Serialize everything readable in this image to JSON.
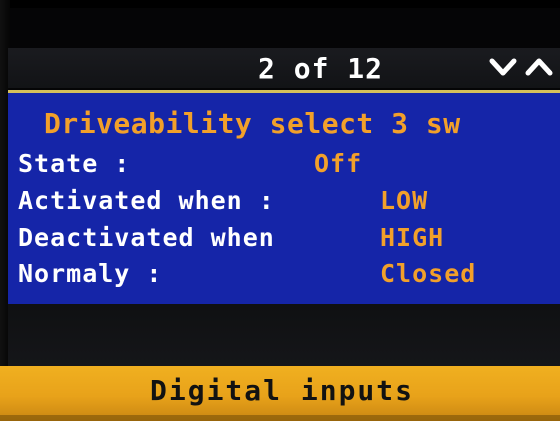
{
  "header": {
    "page_indicator": "2 of 12",
    "nav": {
      "up_icon": "chevron-up-icon",
      "down_icon": "chevron-down-icon"
    }
  },
  "panel": {
    "title": "Driveability select 3 sw",
    "rows": [
      {
        "label": "State  :",
        "value": "Off"
      },
      {
        "label": "Activated when :",
        "value": "LOW"
      },
      {
        "label": "Deactivated when",
        "value": "HIGH"
      },
      {
        "label": "Normaly :",
        "value": "Closed"
      }
    ]
  },
  "footer": {
    "label": "Digital inputs"
  },
  "colors": {
    "panel_background": "#1525a8",
    "accent_value": "#f2a02a",
    "label_text": "#ffffff",
    "footer_background": "#f0b020",
    "header_background": "#1a1b1f"
  }
}
